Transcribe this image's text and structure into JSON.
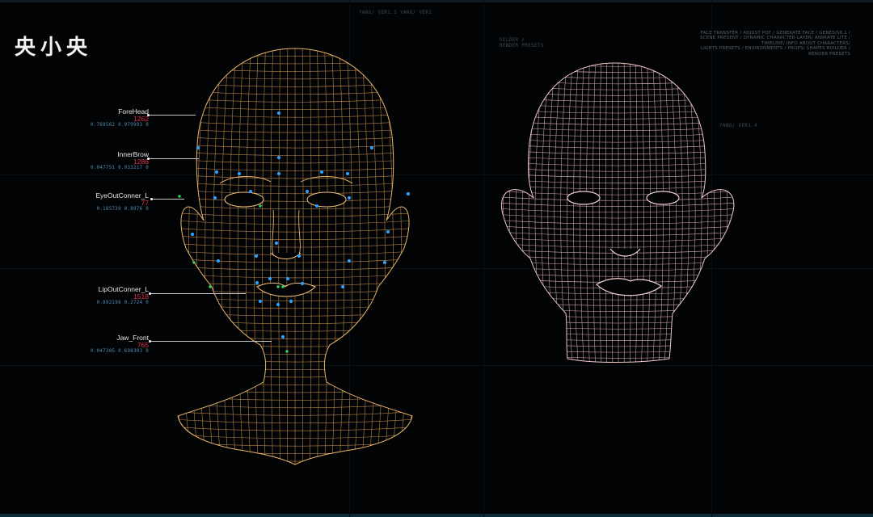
{
  "logo": "央小央",
  "top_labels": {
    "left": "YANG/ VER1.1",
    "right": "YANG/ VER1"
  },
  "center_labels": {
    "line1": "UILDER /",
    "line2": "RENDER PRESETS"
  },
  "menu": {
    "line1": "FACE TRANSFER  /  ADJUST POF / GENERATE FACE / GENESIS8.1 /",
    "line2": "SCENE PRESENT  / DYNAMIC  CHARACTER LAYER/  ANIMATE LITE /",
    "line3": "TIMELINE/  INFO ABOUT CHARACTERS/",
    "line4": "LIGHTS PRESETS  /  ENVIRONMENTS /  PROPS/  SHAPES BUILDER /",
    "line5": "RENDER PRESETS"
  },
  "right_label": "YANG/ VER1.4",
  "colors": {
    "left_mesh": "#e8b46a",
    "right_mesh": "#f0c6c6",
    "landmark_blue": "#2aa0ff",
    "landmark_green": "#2fd860",
    "id_red": "#e0304a",
    "coord_blue": "#4f8fb8"
  },
  "landmarks": [
    {
      "name": "ForeHead",
      "id": "1262",
      "coords": "0.769562 0.979993 0"
    },
    {
      "name": "InnerBrow",
      "id": "1286",
      "coords": "0.047751 0.933217 0"
    },
    {
      "name": "EyeOutConner_L",
      "id": "77",
      "coords": "0.185739 0.8976 0"
    },
    {
      "name": "LipOutConner_L",
      "id": "1518",
      "coords": "0.692196 0.2724 0"
    },
    {
      "name": "Jaw_Front",
      "id": "765",
      "coords": "0.047305 0.698303 0"
    }
  ]
}
